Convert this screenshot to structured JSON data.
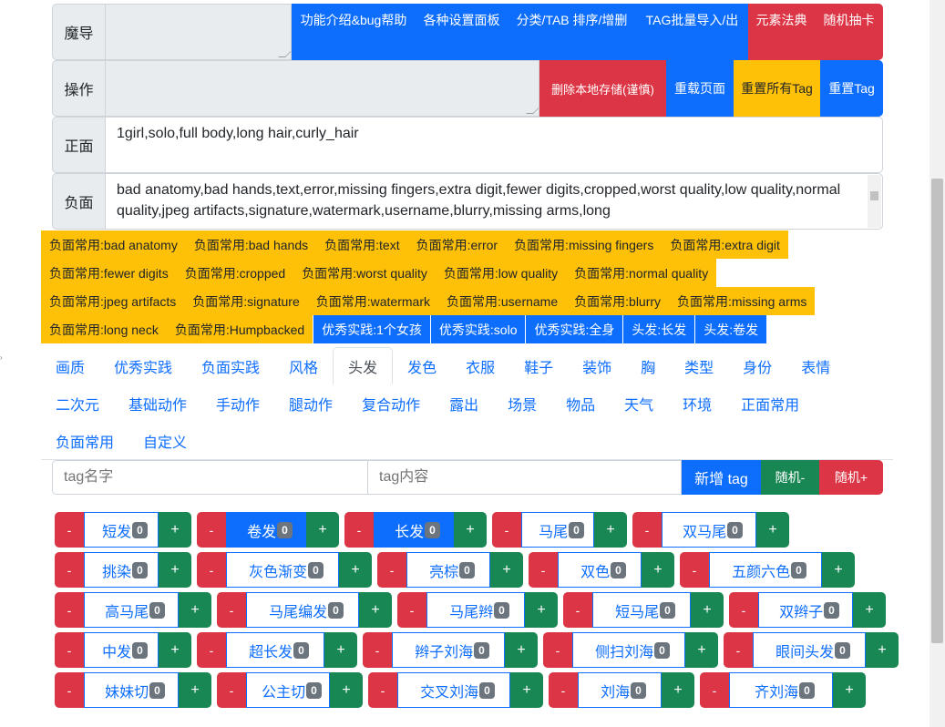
{
  "rows": {
    "mage": {
      "label": "魔导",
      "buttons": [
        "功能介绍&bug帮助",
        "各种设置面板",
        "分类/TAB 排序/增删",
        "TAG批量导入/出",
        "元素法典",
        "随机抽卡"
      ]
    },
    "ops": {
      "label": "操作",
      "buttons": [
        "删除本地存储(谨慎)",
        "重载页面",
        "重置所有Tag",
        "重置Tag"
      ]
    },
    "positive": {
      "label": "正面",
      "value": "1girl,solo,full body,long hair,curly_hair"
    },
    "negative": {
      "label": "负面",
      "value": "bad anatomy,bad hands,text,error,missing fingers,extra digit,fewer digits,cropped,worst quality,low quality,normal quality,jpeg artifacts,signature,watermark,username,blurry,missing arms,long"
    }
  },
  "chips": [
    [
      "负面常用:bad anatomy",
      "负面常用:bad hands",
      "负面常用:text",
      "负面常用:error",
      "负面常用:missing fingers",
      "负面常用:extra digit"
    ],
    [
      "负面常用:fewer digits",
      "负面常用:cropped",
      "负面常用:worst quality",
      "负面常用:low quality",
      "负面常用:normal quality"
    ],
    [
      "负面常用:jpeg artifacts",
      "负面常用:signature",
      "负面常用:watermark",
      "负面常用:username",
      "负面常用:blurry",
      "负面常用:missing arms"
    ],
    [
      "负面常用:long neck",
      "负面常用:Humpbacked"
    ]
  ],
  "blue_chips": [
    "优秀实践:1个女孩",
    "优秀实践:solo",
    "优秀实践:全身",
    "头发:长发",
    "头发:卷发"
  ],
  "tabs": [
    [
      "画质",
      "优秀实践",
      "负面实践",
      "风格",
      "头发",
      "发色",
      "衣服",
      "鞋子",
      "装饰",
      "胸",
      "类型",
      "身份",
      "表情"
    ],
    [
      "二次元",
      "基础动作",
      "手动作",
      "腿动作",
      "复合动作",
      "露出",
      "场景",
      "物品",
      "天气",
      "环境",
      "正面常用"
    ],
    [
      "负面常用",
      "自定义"
    ]
  ],
  "active_tab": "头发",
  "new_tag": {
    "name_placeholder": "tag名字",
    "content_placeholder": "tag内容",
    "add_label": "新增 tag",
    "random_minus": "随机-",
    "random_plus": "随机+"
  },
  "tag_rows": [
    [
      {
        "name": "短发",
        "count": "0"
      },
      {
        "name": "卷发",
        "count": "0",
        "selected": true
      },
      {
        "name": "长发",
        "count": "0",
        "selected": true
      },
      {
        "name": "马尾",
        "count": "0"
      },
      {
        "name": "双马尾",
        "count": "0"
      }
    ],
    [
      {
        "name": "挑染",
        "count": "0"
      },
      {
        "name": "灰色渐变",
        "count": "0"
      },
      {
        "name": "亮棕",
        "count": "0"
      },
      {
        "name": "双色",
        "count": "0"
      },
      {
        "name": "五颜六色",
        "count": "0"
      }
    ],
    [
      {
        "name": "高马尾",
        "count": "0"
      },
      {
        "name": "马尾编发",
        "count": "0"
      },
      {
        "name": "马尾辫",
        "count": "0"
      },
      {
        "name": "短马尾",
        "count": "0"
      },
      {
        "name": "双辫子",
        "count": "0"
      }
    ],
    [
      {
        "name": "中发",
        "count": "0"
      },
      {
        "name": "超长发",
        "count": "0"
      },
      {
        "name": "辫子刘海",
        "count": "0"
      },
      {
        "name": "侧扫刘海",
        "count": "0"
      },
      {
        "name": "眼间头发",
        "count": "0"
      }
    ],
    [
      {
        "name": "妹妹切",
        "count": "0"
      },
      {
        "name": "公主切",
        "count": "0"
      },
      {
        "name": "交叉刘海",
        "count": "0"
      },
      {
        "name": "刘海",
        "count": "0"
      },
      {
        "name": "齐刘海",
        "count": "0"
      }
    ]
  ],
  "minus_label": "-",
  "plus_label": "+"
}
